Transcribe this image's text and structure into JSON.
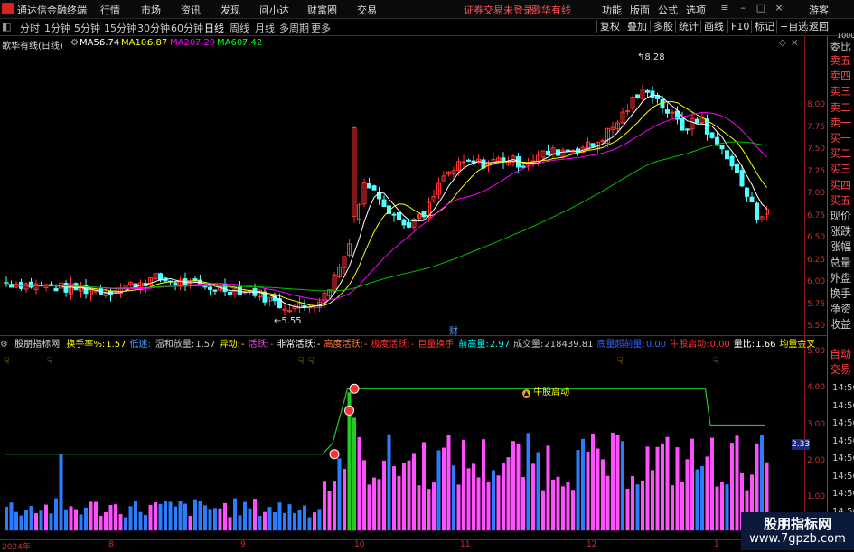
{
  "app": {
    "name": "通达信金融终端",
    "menu": [
      "行情",
      "市场",
      "资讯",
      "发现",
      "问小达",
      "财富圈",
      "交易"
    ],
    "notice_left": "证券交易未登录",
    "notice_stock": "歌华有线",
    "menu_right": [
      "功能",
      "版面",
      "公式",
      "选项"
    ],
    "guest": "游客"
  },
  "toolbar": {
    "periods": [
      "分时",
      "1分钟",
      "5分钟",
      "15分钟",
      "30分钟",
      "60分钟",
      "日线",
      "周线",
      "月线",
      "多周期",
      "更多"
    ],
    "active_period": "日线",
    "right_buttons": [
      "复权",
      "叠加",
      "多股",
      "统计",
      "画线",
      "F10",
      "标记",
      "+自选",
      "返回"
    ]
  },
  "price_panel": {
    "title": "歌华有线(日线)",
    "ma": [
      {
        "label": "MA5:",
        "value": "6.74",
        "color": "#ffffff"
      },
      {
        "label": "MA10:",
        "value": "6.87",
        "color": "#ffff00"
      },
      {
        "label": "MA20:",
        "value": "7.29",
        "color": "#ff00ff"
      },
      {
        "label": "MA60:",
        "value": "7.42",
        "color": "#00ff00"
      }
    ],
    "high_label": "8.28",
    "low_label": "5.55",
    "event_tag": "财",
    "y_ticks": [
      "8.00",
      "7.75",
      "7.50",
      "7.25",
      "7.00",
      "6.75",
      "6.50",
      "6.25",
      "6.00",
      "5.75",
      "5.50"
    ]
  },
  "side_panel": {
    "top_hdr": [
      "委比",
      "1000"
    ],
    "items": [
      "卖五",
      "卖四",
      "卖三",
      "卖二",
      "卖一",
      "买一",
      "买二",
      "买三",
      "买四",
      "买五",
      "现价",
      "涨跌",
      "涨幅",
      "总量",
      "外盘",
      "换手",
      "净资",
      "收益"
    ],
    "lower_items": [
      "自动",
      "交易"
    ],
    "time_ticks": [
      "14:56",
      "14:56",
      "14:56",
      "14:56",
      "14:56",
      "14:56",
      "14:56",
      "14:56",
      "14:56",
      "14:56"
    ],
    "highlight_value": "2.33"
  },
  "indicator": {
    "name": "股朋指标网",
    "fields": [
      {
        "label": "换手率%:",
        "value": "1.57",
        "color": "#ffff00"
      },
      {
        "label": "低迷:",
        "value": "",
        "color": "#4aa0ff"
      },
      {
        "label": "温和放量:",
        "value": "1.57",
        "color": "#c8c8c8"
      },
      {
        "label": "异动:",
        "value": "-",
        "color": "#ffff00"
      },
      {
        "label": "活跃:",
        "value": "-",
        "color": "#ff40ff"
      },
      {
        "label": "非常活跃:",
        "value": "-",
        "color": "#ffffff"
      },
      {
        "label": "高度活跃:",
        "value": "-",
        "color": "#ff8040"
      },
      {
        "label": "极度活跃:",
        "value": "-",
        "color": "#ff3030"
      },
      {
        "label": "巨量换手",
        "value": "",
        "color": "#ff3030"
      },
      {
        "label": "前高量:",
        "value": "2.97",
        "color": "#00ffff"
      },
      {
        "label": "成交量:",
        "value": "218439.81",
        "color": "#c8c8c8"
      },
      {
        "label": "底量超前量:",
        "value": "0.00",
        "color": "#3060ff"
      },
      {
        "label": "牛股启动:",
        "value": "0.00",
        "color": "#ff3030"
      },
      {
        "label": "量比:",
        "value": "1.66",
        "color": "#ffffff"
      },
      {
        "label": "均量金叉",
        "value": "",
        "color": "#ffff00"
      }
    ],
    "y_ticks": [
      "5.00",
      "4.00",
      "3.00",
      "2.00",
      "1.00"
    ],
    "annotation": "牛股启动"
  },
  "x_axis": [
    "2024年",
    "8",
    "9",
    "10",
    "11",
    "12",
    "1"
  ],
  "watermark": {
    "line1": "股朋指标网",
    "line2": "www.7gpzb.com"
  },
  "colors": {
    "up": "#ff3232",
    "down": "#54ffff",
    "ma5": "#ffffff",
    "ma10": "#ffff00",
    "ma20": "#ff00ff",
    "ma60": "#00c000",
    "vol_up": "#ff50ff",
    "vol_down": "#2c7cff"
  }
}
